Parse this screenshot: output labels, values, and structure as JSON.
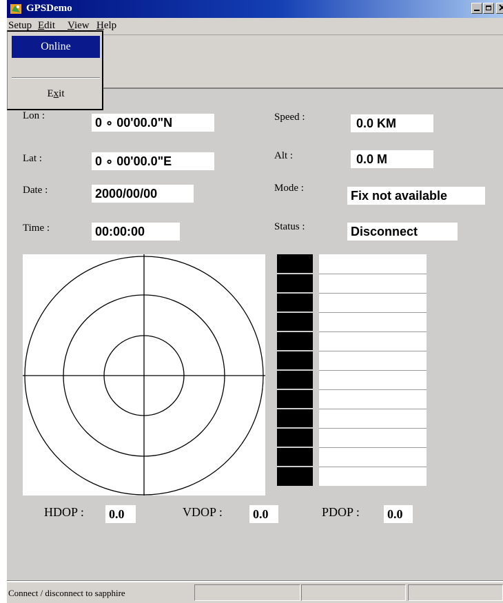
{
  "window": {
    "title": "GPSDemo"
  },
  "menubar": {
    "items": [
      {
        "pre": "Setup",
        "ul": "",
        "post": ""
      },
      {
        "pre": "",
        "ul": "E",
        "post": "dit"
      },
      {
        "pre": "",
        "ul": "V",
        "post": "iew"
      },
      {
        "pre": "",
        "ul": "H",
        "post": "elp"
      }
    ]
  },
  "setup_menu": {
    "online": "Online",
    "exit_pre": "E",
    "exit_ul": "x",
    "exit_post": "it"
  },
  "fields": {
    "lon": {
      "label": "Lon :",
      "value": "0 ∘ 00'00.0\"N"
    },
    "lat": {
      "label": "Lat :",
      "value": "0 ∘ 00'00.0\"E"
    },
    "date": {
      "label": "Date :",
      "value": "2000/00/00"
    },
    "time": {
      "label": "Time :",
      "value": "00:00:00"
    },
    "speed": {
      "label": "Speed :",
      "value": "0.0 KM"
    },
    "alt": {
      "label": "Alt :",
      "value": "0.0 M"
    },
    "mode": {
      "label": "Mode :",
      "value": "Fix not available"
    },
    "status": {
      "label": "Status :",
      "value": "Disconnect"
    }
  },
  "dop": {
    "hdop": {
      "label": "HDOP :",
      "value": "0.0"
    },
    "vdop": {
      "label": "VDOP :",
      "value": "0.0"
    },
    "pdop": {
      "label": "PDOP :",
      "value": "0.0"
    }
  },
  "signal_bars": {
    "count": 12,
    "levels": [
      0,
      0,
      0,
      0,
      0,
      0,
      0,
      0,
      0,
      0,
      0,
      0
    ]
  },
  "statusbar": {
    "text": "Connect / disconnect to sapphire"
  },
  "colors": {
    "title_start": "#000c7b",
    "menu_highlight": "#0a1a8c",
    "panel": "#cfcccc"
  }
}
